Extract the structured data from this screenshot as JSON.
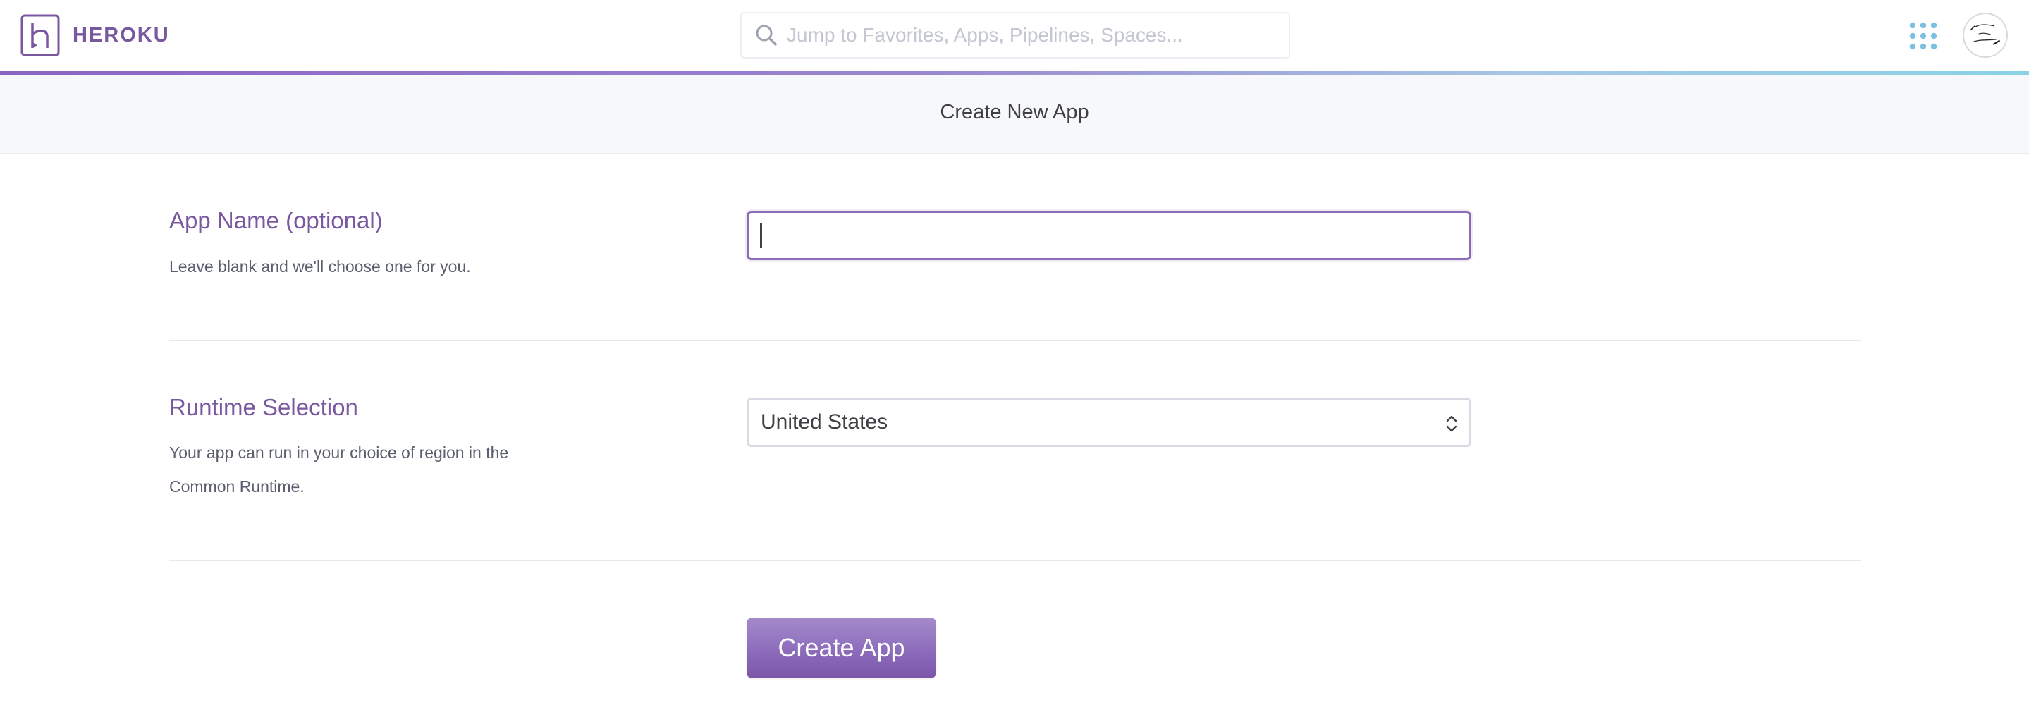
{
  "header": {
    "brand_name": "HEROKU",
    "search": {
      "placeholder": "Jump to Favorites, Apps, Pipelines, Spaces..."
    },
    "icons": [
      "heroku-logo-icon",
      "search-icon",
      "apps-grid-icon",
      "avatar"
    ]
  },
  "page": {
    "title": "Create New App"
  },
  "form": {
    "app_name": {
      "label": "App Name (optional)",
      "help": "Leave blank and we'll choose one for you.",
      "value": ""
    },
    "runtime": {
      "label": "Runtime Selection",
      "help": "Your app can run in your choice of region in the Common Runtime.",
      "selected": "United States"
    },
    "submit_label": "Create App"
  },
  "colors": {
    "brand": "#79589f",
    "apps_grid": "#7cbfe3",
    "button": "#8d6cbc",
    "subheader_bg": "#f7f8fb"
  }
}
